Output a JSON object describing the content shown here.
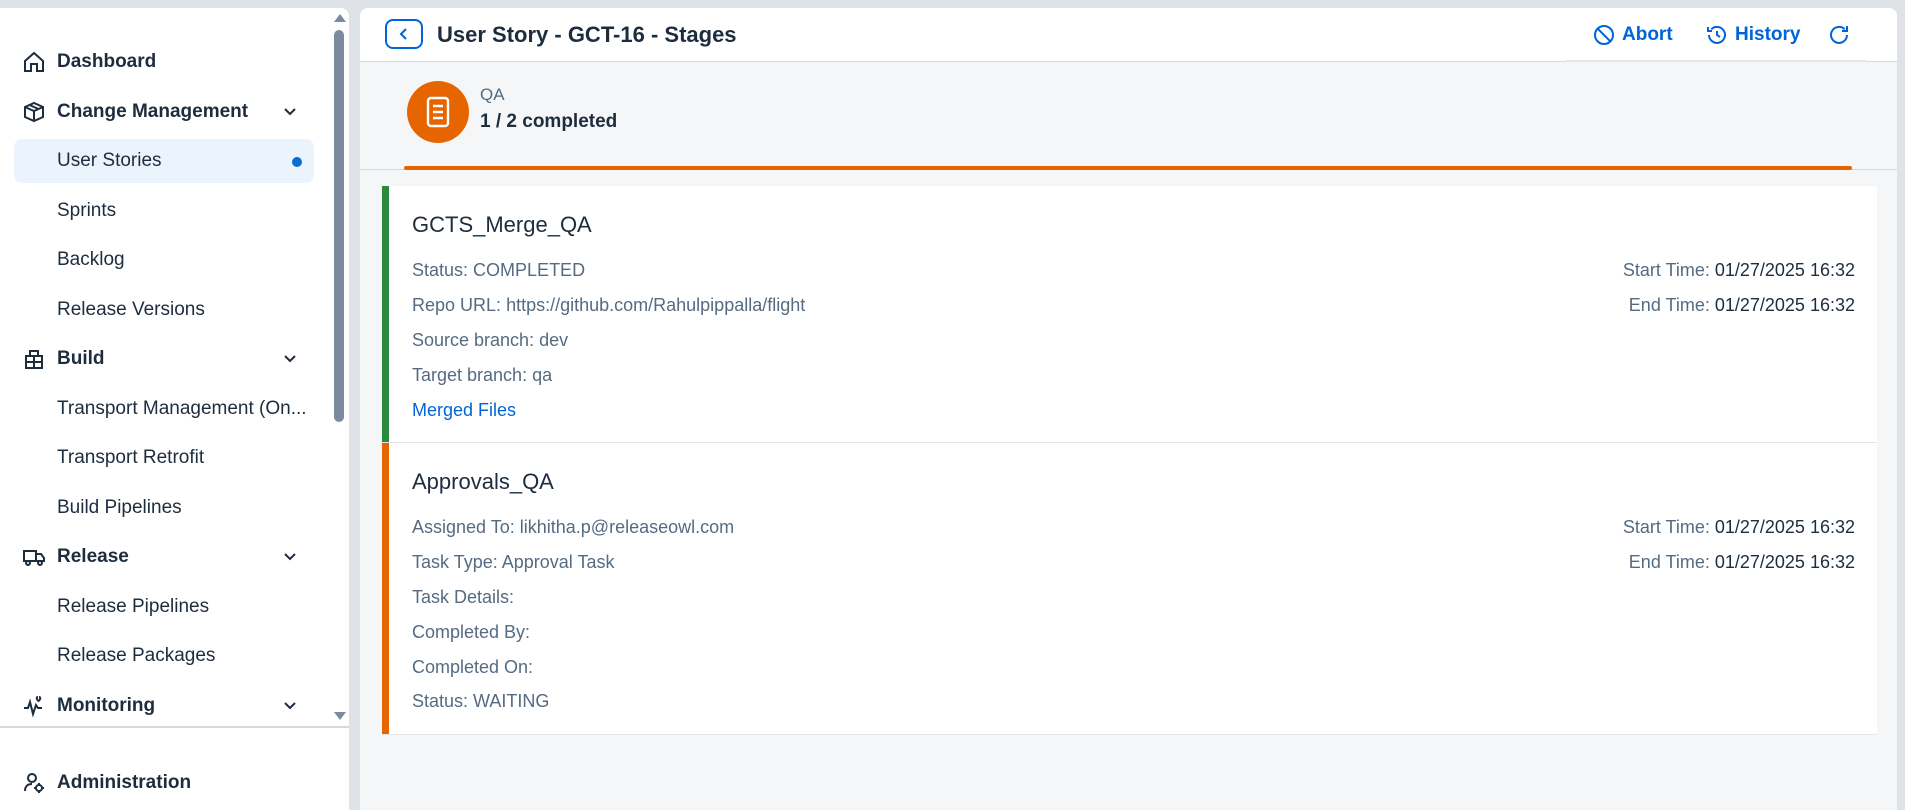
{
  "sidebar": {
    "items": [
      {
        "label": "Dashboard",
        "icon": "home-icon"
      },
      {
        "label": "Change Management",
        "icon": "change-management-icon"
      },
      {
        "label": "User Stories"
      },
      {
        "label": "Sprints"
      },
      {
        "label": "Backlog"
      },
      {
        "label": "Release Versions"
      },
      {
        "label": "Build",
        "icon": "build-icon"
      },
      {
        "label": "Transport Management (On..."
      },
      {
        "label": "Transport Retrofit"
      },
      {
        "label": "Build Pipelines"
      },
      {
        "label": "Release",
        "icon": "truck-icon"
      },
      {
        "label": "Release Pipelines"
      },
      {
        "label": "Release Packages"
      },
      {
        "label": "Monitoring",
        "icon": "monitoring-icon"
      }
    ],
    "fixed_item": {
      "label": "Administration",
      "icon": "user-settings-icon"
    }
  },
  "header": {
    "title": "User Story - GCT-16 - Stages",
    "abort_label": "Abort",
    "history_label": "History"
  },
  "stage": {
    "name": "QA",
    "progress": "1 / 2 completed"
  },
  "cards": [
    {
      "title": "GCTS_Merge_QA",
      "status": "COMPLETED",
      "status_color": "#2b8a3e",
      "fields": [
        {
          "label": "Status:",
          "value": "COMPLETED"
        },
        {
          "label": "Repo URL:",
          "value": "https://github.com/Rahulpippalla/flight"
        },
        {
          "label": "Source branch:",
          "value": "dev"
        },
        {
          "label": "Target branch:",
          "value": "qa"
        }
      ],
      "link": "Merged Files",
      "start_label": "Start Time:",
      "start_value": "01/27/2025 16:32",
      "end_label": "End Time:",
      "end_value": "01/27/2025 16:32"
    },
    {
      "title": "Approvals_QA",
      "status": "WAITING",
      "status_color": "#e76500",
      "fields": [
        {
          "label": "Assigned To:",
          "value": "likhitha.p@releaseowl.com"
        },
        {
          "label": "Task Type:",
          "value": "Approval Task"
        },
        {
          "label": "Task Details:",
          "value": ""
        },
        {
          "label": "Completed By:",
          "value": ""
        },
        {
          "label": "Completed On:",
          "value": ""
        },
        {
          "label": "Status:",
          "value": "WAITING"
        }
      ],
      "start_label": "Start Time:",
      "start_value": "01/27/2025 16:32",
      "end_label": "End Time:",
      "end_value": "01/27/2025 16:32"
    }
  ],
  "colors": {
    "accent_blue": "#0064d9",
    "accent_orange": "#e76500",
    "success_green": "#2b8a3e",
    "selected_bg": "#ebf4fd"
  }
}
